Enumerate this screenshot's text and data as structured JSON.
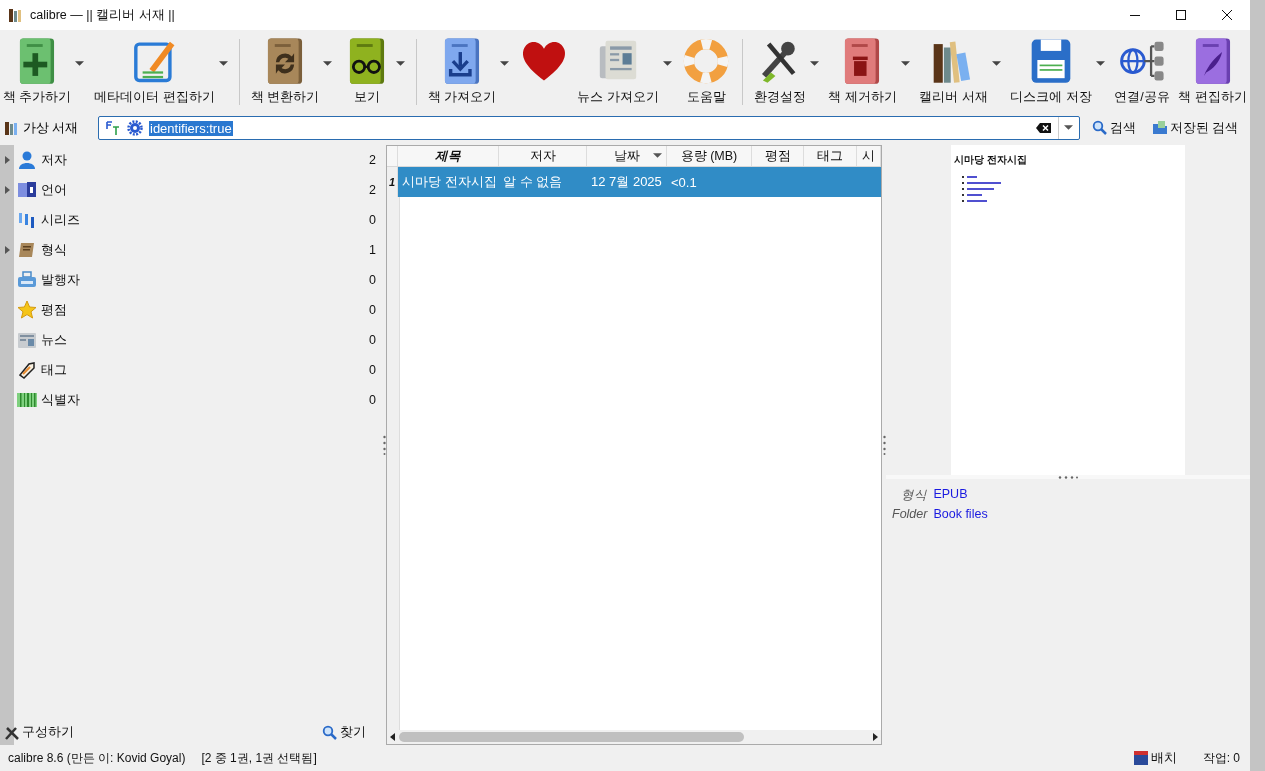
{
  "window": {
    "title": "calibre — || 캘리버 서재 ||"
  },
  "toolbar": [
    {
      "label": "책 추가하기",
      "dropdown": true,
      "separator_after": false
    },
    {
      "label": "메타데이터 편집하기",
      "dropdown": true,
      "separator_after": true
    },
    {
      "label": "책 변환하기",
      "dropdown": true,
      "separator_after": false
    },
    {
      "label": "보기",
      "dropdown": true,
      "separator_after": true
    },
    {
      "label": "책 가져오기",
      "dropdown": true,
      "separator_after": false
    },
    {
      "dropdown": false,
      "separator_after": false
    },
    {
      "label": "뉴스 가져오기",
      "dropdown": true,
      "separator_after": false
    },
    {
      "label": "도움말",
      "dropdown": false,
      "separator_after": true
    },
    {
      "label": "환경설정",
      "dropdown": true,
      "separator_after": false
    },
    {
      "label": "책 제거하기",
      "dropdown": true,
      "separator_after": false
    },
    {
      "label": "캘리버 서재",
      "dropdown": true,
      "separator_after": false
    },
    {
      "label": "디스크에 저장",
      "dropdown": true,
      "separator_after": false
    },
    {
      "label": "연결/공유",
      "dropdown": false,
      "separator_after": false
    },
    {
      "label": "책 편집하기",
      "dropdown": false,
      "separator_after": false
    }
  ],
  "search_bar": {
    "virtual_library": "가상 서재",
    "value": "identifiers:true",
    "highlighted": true,
    "search_button": "검색",
    "saved_searches": "저장된 검색"
  },
  "tag_browser": {
    "items": [
      {
        "label": "저자",
        "count": "2",
        "expandable": true
      },
      {
        "label": "언어",
        "count": "2",
        "expandable": true
      },
      {
        "label": "시리즈",
        "count": "0",
        "expandable": false
      },
      {
        "label": "형식",
        "count": "1",
        "expandable": true
      },
      {
        "label": "발행자",
        "count": "0",
        "expandable": false
      },
      {
        "label": "평점",
        "count": "0",
        "expandable": false
      },
      {
        "label": "뉴스",
        "count": "0",
        "expandable": false
      },
      {
        "label": "태그",
        "count": "0",
        "expandable": false
      },
      {
        "label": "식별자",
        "count": "0",
        "expandable": false
      }
    ],
    "configure": "구성하기",
    "find": "찾기"
  },
  "table": {
    "columns": [
      {
        "label": "제목",
        "emphasized": true,
        "sorted": false
      },
      {
        "label": "저자",
        "emphasized": false,
        "sorted": false
      },
      {
        "label": "날짜",
        "emphasized": false,
        "sorted": true
      },
      {
        "label": "용량 (MB)",
        "emphasized": false,
        "sorted": false
      },
      {
        "label": "평점",
        "emphasized": false,
        "sorted": false
      },
      {
        "label": "태그",
        "emphasized": false,
        "sorted": false
      },
      {
        "label": "시",
        "emphasized": false,
        "sorted": false
      }
    ],
    "rows": [
      {
        "number": "1",
        "selected": true,
        "cells": [
          "시마당 전자시집",
          "알 수 없음",
          "12  7월 2025",
          "<0.1",
          "",
          "",
          ""
        ]
      }
    ]
  },
  "book_details": {
    "cover_title": "시마당 전자시집",
    "fields": [
      {
        "label": "형식",
        "value": "EPUB"
      },
      {
        "label": "Folder",
        "value": "Book files"
      }
    ]
  },
  "status_bar": {
    "version": "calibre 8.6 (만든 이: Kovid Goyal)",
    "selection": "[2 중 1권, 1권 선택됨]",
    "layout": "배치",
    "jobs": "작업: 0"
  }
}
